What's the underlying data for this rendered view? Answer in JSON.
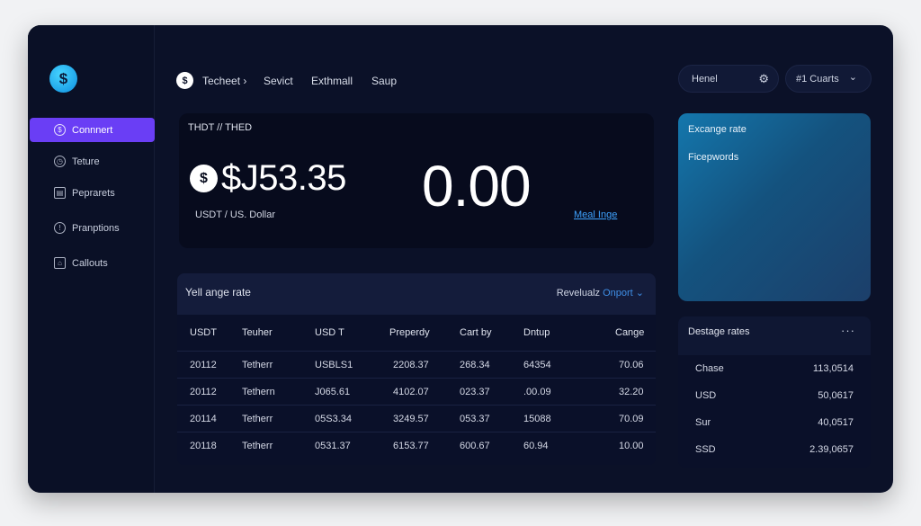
{
  "sidebar": {
    "logo_glyph": "$",
    "items": [
      {
        "label": "Connnert",
        "icon": "dollar-circle-icon",
        "glyph": "$"
      },
      {
        "label": "Teture",
        "icon": "clock-icon",
        "glyph": "◷"
      },
      {
        "label": "Peprarets",
        "icon": "document-icon",
        "glyph": "▤"
      },
      {
        "label": "Pranptions",
        "icon": "info-circle-icon",
        "glyph": "!"
      },
      {
        "label": "Callouts",
        "icon": "home-icon",
        "glyph": "⌂"
      }
    ]
  },
  "topbar": {
    "brand_glyph": "$",
    "links": [
      "Techeet ›",
      "Sevict",
      "Exthmall",
      "Saup"
    ],
    "search_label": "Henel",
    "gear_glyph": "⚙",
    "account_label": "#1 Cuarts",
    "account_chevron": "⌄"
  },
  "hero": {
    "pair": "THDT // THED",
    "coin_glyph": "$",
    "amount": "$J53.35",
    "subtitle": "USDT / US. Dollar",
    "zero_value": "0.00",
    "link": "Meal Inge"
  },
  "exchange_card": {
    "title": "Excange rate",
    "subtitle": "Ficepwords"
  },
  "table": {
    "title": "Yell ange rate",
    "action_prefix": "Revelualz",
    "action_accent": "Onport ⌄",
    "columns": [
      "USDT",
      "Teuher",
      "USD T",
      "Preperdy",
      "Cart by",
      "Dntup",
      "Cange"
    ],
    "rows": [
      [
        "20112",
        "Tetherr",
        "USBLS1",
        "2208.37",
        "268.34",
        "64354",
        "70.06"
      ],
      [
        "20112",
        "Tethern",
        "J065.61",
        "4102.07",
        "023.37",
        ".00.09",
        "32.20"
      ],
      [
        "20114",
        "Tetherr",
        "05S3.34",
        "3249.57",
        "053.37",
        "15088",
        "70.09"
      ],
      [
        "20118",
        "Tetherr",
        "0531.37",
        "6153.77",
        "600.67",
        "60.94",
        "10.00"
      ]
    ]
  },
  "rates": {
    "title": "Destage rates",
    "more_glyph": "···",
    "rows": [
      {
        "key": "Chase",
        "value": "113,0514"
      },
      {
        "key": "USD",
        "value": "50,0617"
      },
      {
        "key": "Sur",
        "value": "40,0517"
      },
      {
        "key": "SSD",
        "value": "2.39,0657"
      }
    ]
  }
}
